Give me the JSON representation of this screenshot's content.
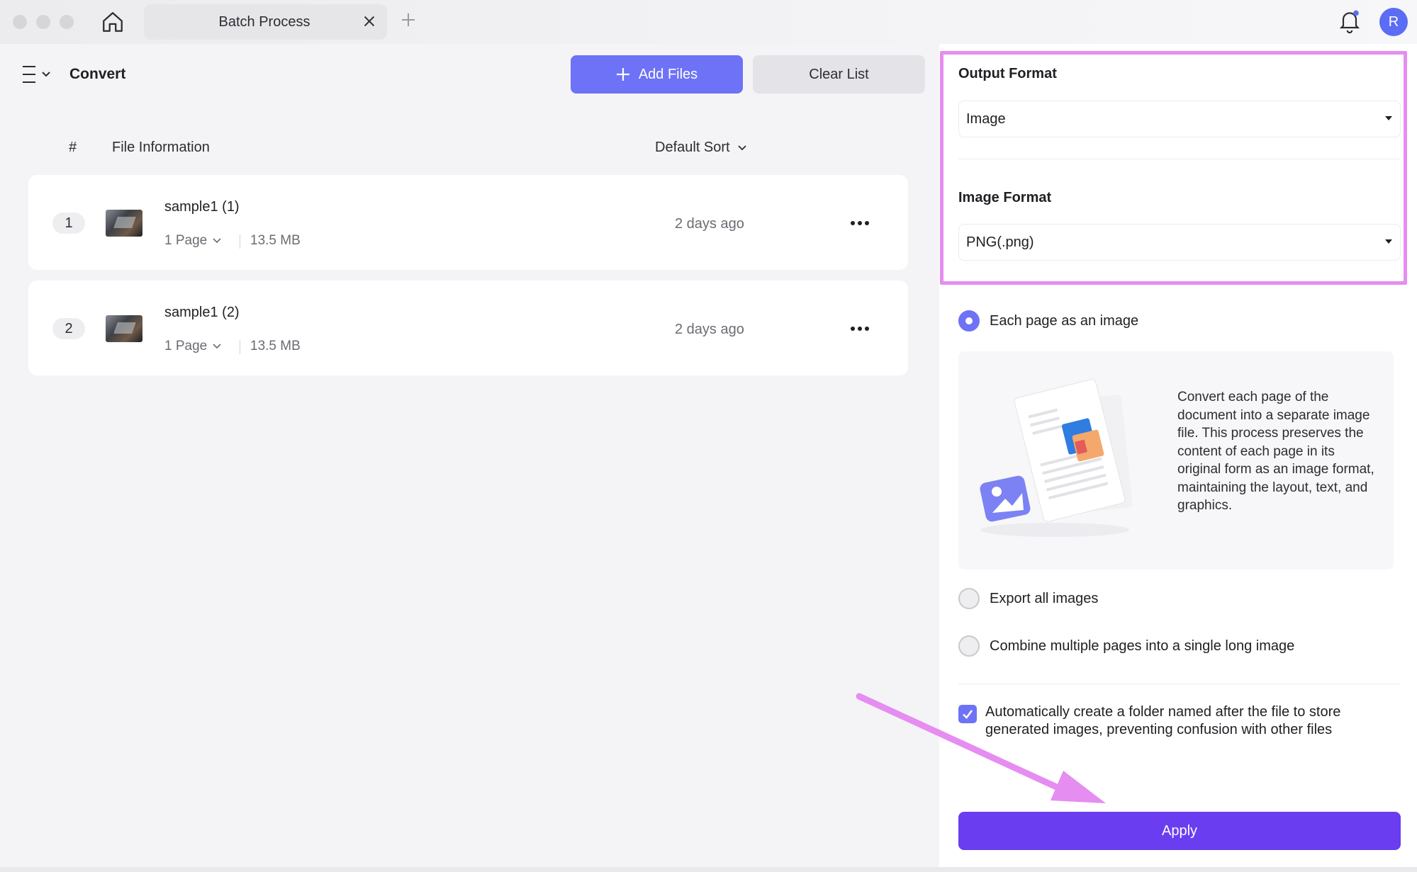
{
  "titlebar": {
    "tab_title": "Batch Process",
    "avatar_initial": "R"
  },
  "left": {
    "title": "Convert",
    "add_files_label": "Add Files",
    "clear_list_label": "Clear List",
    "columns": {
      "hash": "#",
      "info": "File Information",
      "sort": "Default Sort"
    },
    "files": [
      {
        "num": "1",
        "name": "sample1 (1)",
        "pages": "1 Page",
        "size": "13.5 MB",
        "date": "2 days ago"
      },
      {
        "num": "2",
        "name": "sample1 (2)",
        "pages": "1 Page",
        "size": "13.5 MB",
        "date": "2 days ago"
      }
    ]
  },
  "right": {
    "output_format_label": "Output Format",
    "output_format_value": "Image",
    "image_format_label": "Image Format",
    "image_format_value": "PNG(.png)",
    "options": [
      {
        "label": "Each page as an image",
        "selected": true
      },
      {
        "label": "Export all images",
        "selected": false
      },
      {
        "label": "Combine multiple pages into a single long image",
        "selected": false
      }
    ],
    "description": "Convert each page of the document into a separate image file. This process preserves the content of each page in its original form as an image format, maintaining the layout, text, and graphics.",
    "auto_folder_label": "Automatically create a folder named after the file to store generated images, preventing confusion with other files",
    "auto_folder_checked": true,
    "apply_label": "Apply"
  },
  "colors": {
    "accent": "#6d72f6",
    "apply": "#6a3df0",
    "annotation": "#e58df0"
  },
  "icons": [
    "home-icon",
    "close-icon",
    "plus-icon",
    "bell-icon",
    "menu-icon",
    "chevron-down-icon",
    "more-icon",
    "check-icon",
    "caret-down-icon"
  ]
}
